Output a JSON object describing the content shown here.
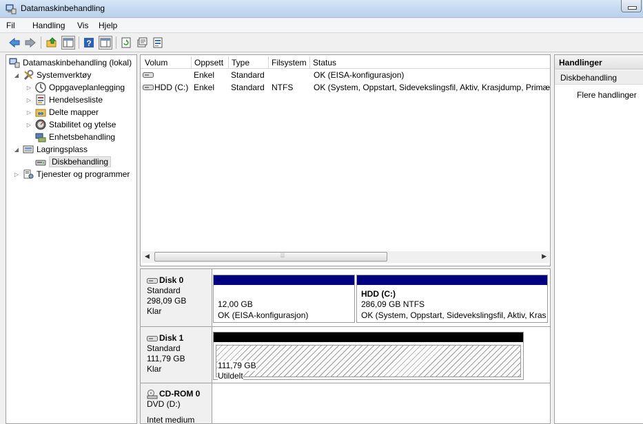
{
  "window": {
    "title": "Datamaskinbehandling"
  },
  "menu": [
    "Fil",
    "Handling",
    "Vis",
    "Hjelp"
  ],
  "toolbar": {
    "icons": [
      "back-arrow-icon",
      "forward-arrow-icon",
      "up-folder-icon",
      "show-hide-tree-icon",
      "help-icon",
      "show-hide-actions-icon",
      "refresh-icon",
      "properties-icon",
      "export-list-icon"
    ]
  },
  "tree": {
    "root": "Datamaskinbehandling (lokal)",
    "systemverktoy": "Systemverktøy",
    "oppgaveplanlegging": "Oppgaveplanlegging",
    "hendelsesliste": "Hendelsesliste",
    "delte_mapper": "Delte mapper",
    "stabilitet": "Stabilitet og ytelse",
    "enhetsbehandling": "Enhetsbehandling",
    "lagringsplass": "Lagringsplass",
    "diskbehandling": "Diskbehandling",
    "tjenester": "Tjenester og programmer"
  },
  "volume_list": {
    "columns": [
      "Volum",
      "Oppsett",
      "Type",
      "Filsystem",
      "Status"
    ],
    "rows": [
      {
        "volum": "",
        "oppsett": "Enkel",
        "type": "Standard",
        "filsystem": "",
        "status": "OK (EISA-konfigurasjon)"
      },
      {
        "volum": "HDD (C:)",
        "oppsett": "Enkel",
        "type": "Standard",
        "filsystem": "NTFS",
        "status": "OK (System, Oppstart, Sidevekslingsfil, Aktiv, Krasjdump, Primær partisjon)"
      }
    ]
  },
  "disks": [
    {
      "name": "Disk 0",
      "type": "Standard",
      "size": "298,09 GB",
      "state": "Klar",
      "partitions": [
        {
          "label": "",
          "size": "12,00 GB",
          "status": "OK (EISA-konfigurasjon)"
        },
        {
          "label": "HDD  (C:)",
          "size": "286,09 GB NTFS",
          "status": "OK (System, Oppstart, Sidevekslingsfil, Aktiv, Krasjdump, Primær partisjon)"
        }
      ]
    },
    {
      "name": "Disk 1",
      "type": "Standard",
      "size": "111,79 GB",
      "state": "Klar",
      "partitions": [
        {
          "size": "111,79 GB",
          "status": "Utildelt"
        }
      ]
    },
    {
      "name": "CD-ROM 0",
      "type": "DVD (D:)",
      "media": "Intet medium"
    }
  ],
  "actions": {
    "header": "Handlinger",
    "section": "Diskbehandling",
    "more": "Flere handlinger"
  },
  "colors": {
    "primary_partition_bar": "#00007f",
    "unallocated_bar": "#000000"
  }
}
